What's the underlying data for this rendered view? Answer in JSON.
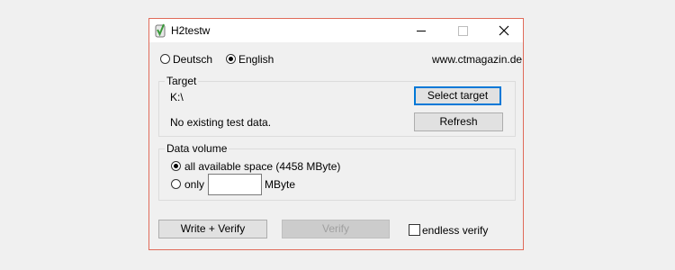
{
  "window": {
    "title": "H2testw",
    "controls": {
      "minimize": "–",
      "maximize": "☐",
      "close": "✕"
    }
  },
  "language": {
    "options": [
      "Deutsch",
      "English"
    ],
    "selected": "English"
  },
  "website_link": "www.ctmagazin.de",
  "target": {
    "group_label": "Target",
    "path": "K:\\",
    "status": "No existing test data.",
    "select_button": "Select target",
    "refresh_button": "Refresh"
  },
  "data_volume": {
    "group_label": "Data volume",
    "option_all": "all available space (4458 MByte)",
    "option_only": "only",
    "only_value": "",
    "unit": "MByte",
    "selected": "all"
  },
  "actions": {
    "write_verify": "Write + Verify",
    "verify": "Verify",
    "endless_verify": "endless verify",
    "endless_checked": false
  },
  "colors": {
    "window_border": "#e06b5a",
    "focus_border": "#0078d7",
    "icon_green": "#3a9a3a"
  }
}
